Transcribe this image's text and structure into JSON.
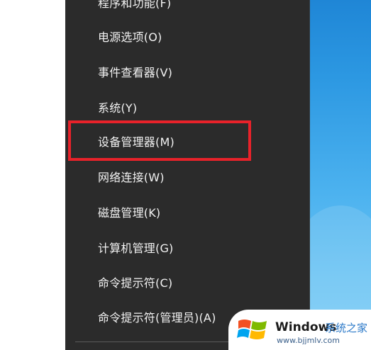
{
  "menu": {
    "items": [
      {
        "label": "程序和功能(F)"
      },
      {
        "label": "电源选项(O)"
      },
      {
        "label": "事件查看器(V)"
      },
      {
        "label": "系统(Y)"
      },
      {
        "label": "设备管理器(M)"
      },
      {
        "label": "网络连接(W)"
      },
      {
        "label": "磁盘管理(K)"
      },
      {
        "label": "计算机管理(G)"
      },
      {
        "label": "命令提示符(C)"
      },
      {
        "label": "命令提示符(管理员)(A)"
      }
    ],
    "highlighted_item": "设备管理器(M)",
    "highlight_color": "#e8222a",
    "background_color": "#2b2b2b"
  },
  "watermark": {
    "brand": "Windows",
    "brand_sub": "系统之家",
    "url": "www.bjjmlv.com",
    "logo_icon": "windows-logo-icon"
  }
}
